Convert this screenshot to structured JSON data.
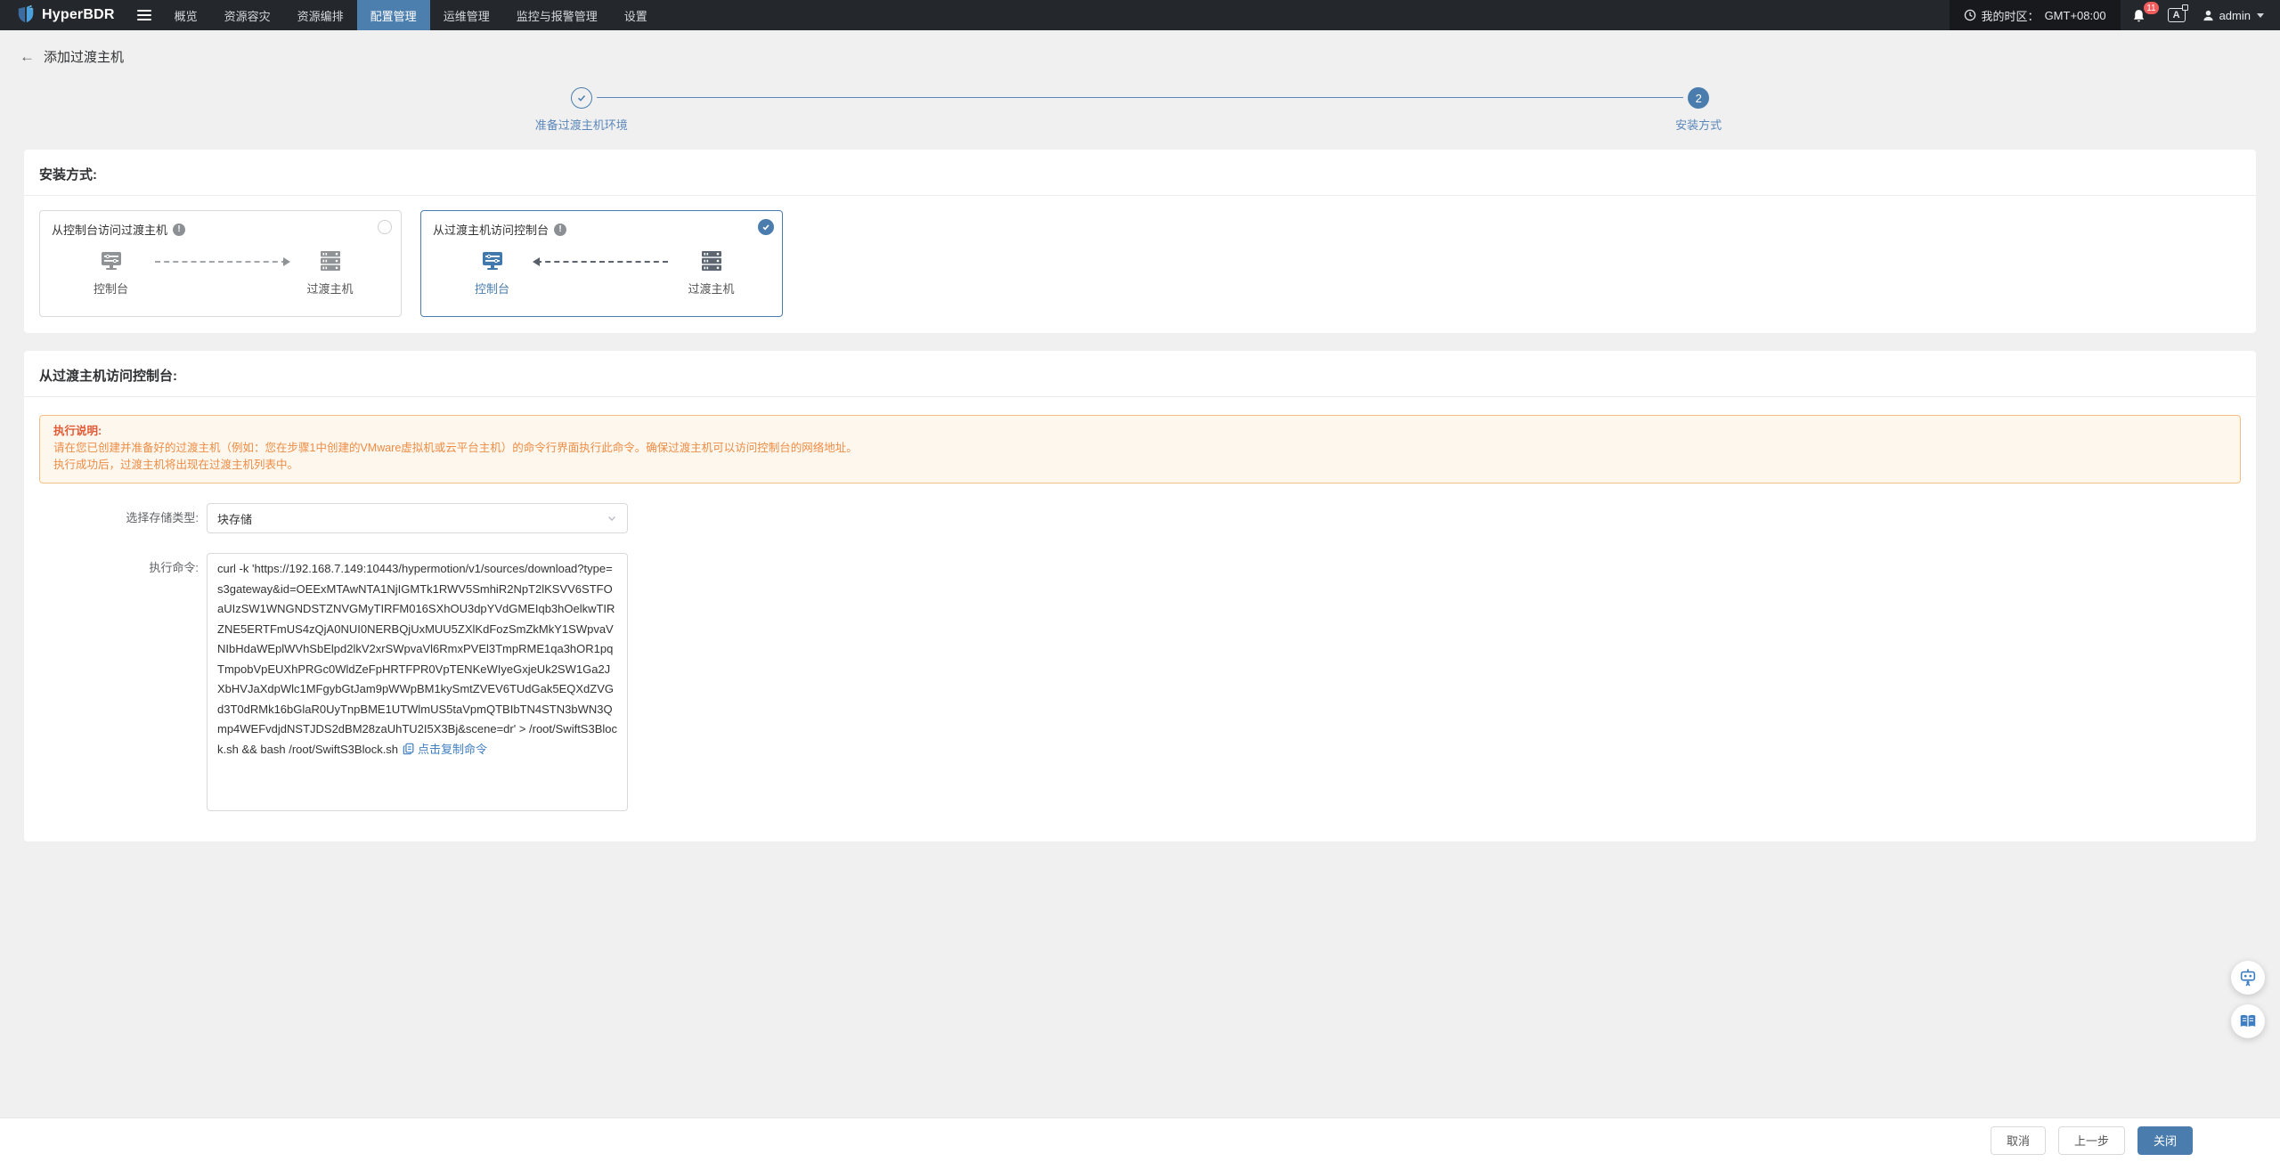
{
  "topbar": {
    "brand": "HyperBDR",
    "nav": [
      "概览",
      "资源容灾",
      "资源编排",
      "配置管理",
      "运维管理",
      "监控与报警管理",
      "设置"
    ],
    "timezone_label": "我的时区：",
    "timezone_value": "GMT+08:00",
    "notification_count": "11",
    "language_icon_letter": "A",
    "username": "admin"
  },
  "page": {
    "back_icon": "←",
    "title": "添加过渡主机",
    "steps": [
      {
        "label": "准备过渡主机环境",
        "status": "done"
      },
      {
        "number": "2",
        "label": "安装方式",
        "status": "active"
      }
    ]
  },
  "install": {
    "heading": "安装方式:",
    "options": [
      {
        "title": "从控制台访问过渡主机",
        "left_label": "控制台",
        "right_label": "过渡主机",
        "selected": false
      },
      {
        "title": "从过渡主机访问控制台",
        "left_label": "控制台",
        "right_label": "过渡主机",
        "selected": true
      }
    ]
  },
  "config": {
    "heading": "从过渡主机访问控制台:",
    "notice": {
      "title": "执行说明:",
      "line1": "请在您已创建并准备好的过渡主机（例如：您在步骤1中创建的VMware虚拟机或云平台主机）的命令行界面执行此命令。确保过渡主机可以访问控制台的网络地址。",
      "line2": "执行成功后，过渡主机将出现在过渡主机列表中。"
    },
    "storage": {
      "label": "选择存储类型:",
      "value": "块存储"
    },
    "command": {
      "label": "执行命令:",
      "value": "curl -k 'https://192.168.7.149:10443/hypermotion/v1/sources/download?type=s3gateway&id=OEExMTAwNTA1NjIGMTk1RWV5SmhiR2NpT2lKSVV6STFOaUIzSW1WNGNDSTZNVGMyTIRFM016SXhOU3dpYVdGMEIqb3hOelkwTIRZNE5ERTFmUS4zQjA0NUI0NERBQjUxMUU5ZXlKdFozSmZkMkY1SWpvaVNIbHdaWEplWVhSbElpd2lkV2xrSWpvaVl6RmxPVEl3TmpRME1qa3hOR1pqTmpobVpEUXhPRGc0WldZeFpHRTFPR0VpTENKeWIyeGxjeUk2SW1Ga2JXbHVJaXdpWlc1MFgybGtJam9pWWpBM1kySmtZVEV6TUdGak5EQXdZVGd3T0dRMk16bGlaR0UyTnpBME1UTWlmUS5taVpmQTBIbTN4STN3bWN3Qmp4WEFvdjdNSTJDS2dBM28zaUhTU2I5X3Bj&scene=dr' > /root/SwiftS3Block.sh && bash /root/SwiftS3Block.sh",
      "copy_label": "点击复制命令"
    }
  },
  "footer": {
    "cancel": "取消",
    "prev": "上一步",
    "close": "关闭"
  },
  "colors": {
    "accent": "#4a7dad",
    "topbar_bg": "#24282c",
    "alert_border": "#f3c083",
    "alert_bg": "#fdf7ee",
    "alert_text": "#ee8c44",
    "badge_red": "#f25c5c"
  }
}
